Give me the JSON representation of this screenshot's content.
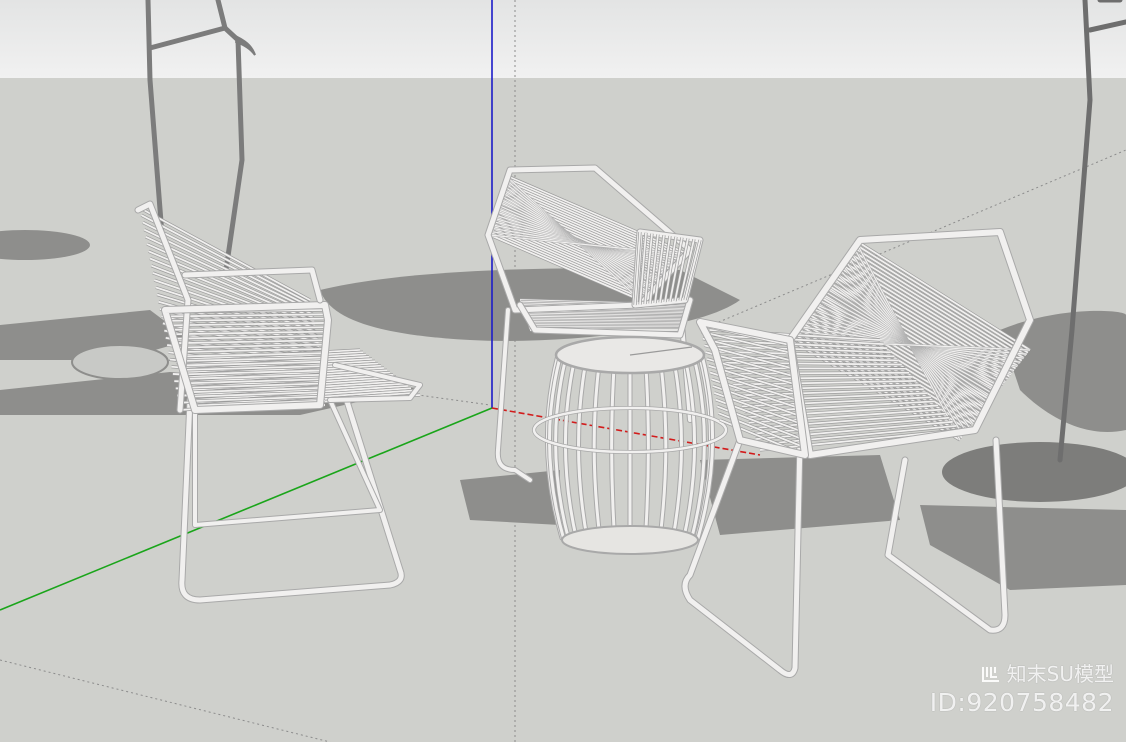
{
  "watermark": {
    "brand": "知末SU模型",
    "id": "ID:920758482"
  },
  "colors": {
    "sky": "#e9eaea",
    "ground": "#cfd0cc",
    "shadow": "#8f8f8d",
    "rattan": "#f1f0ef",
    "rattan_edge": "#a9a9a9",
    "axis_red": "#d21b1b",
    "axis_green": "#1aa51a",
    "axis_blue": "#1b1bc8"
  },
  "objects": {
    "chairs": [
      "left-chair",
      "back-chair",
      "right-chair"
    ],
    "table": "round-side-table",
    "poles": [
      "left-floor-lamp",
      "right-floor-lamp"
    ]
  }
}
